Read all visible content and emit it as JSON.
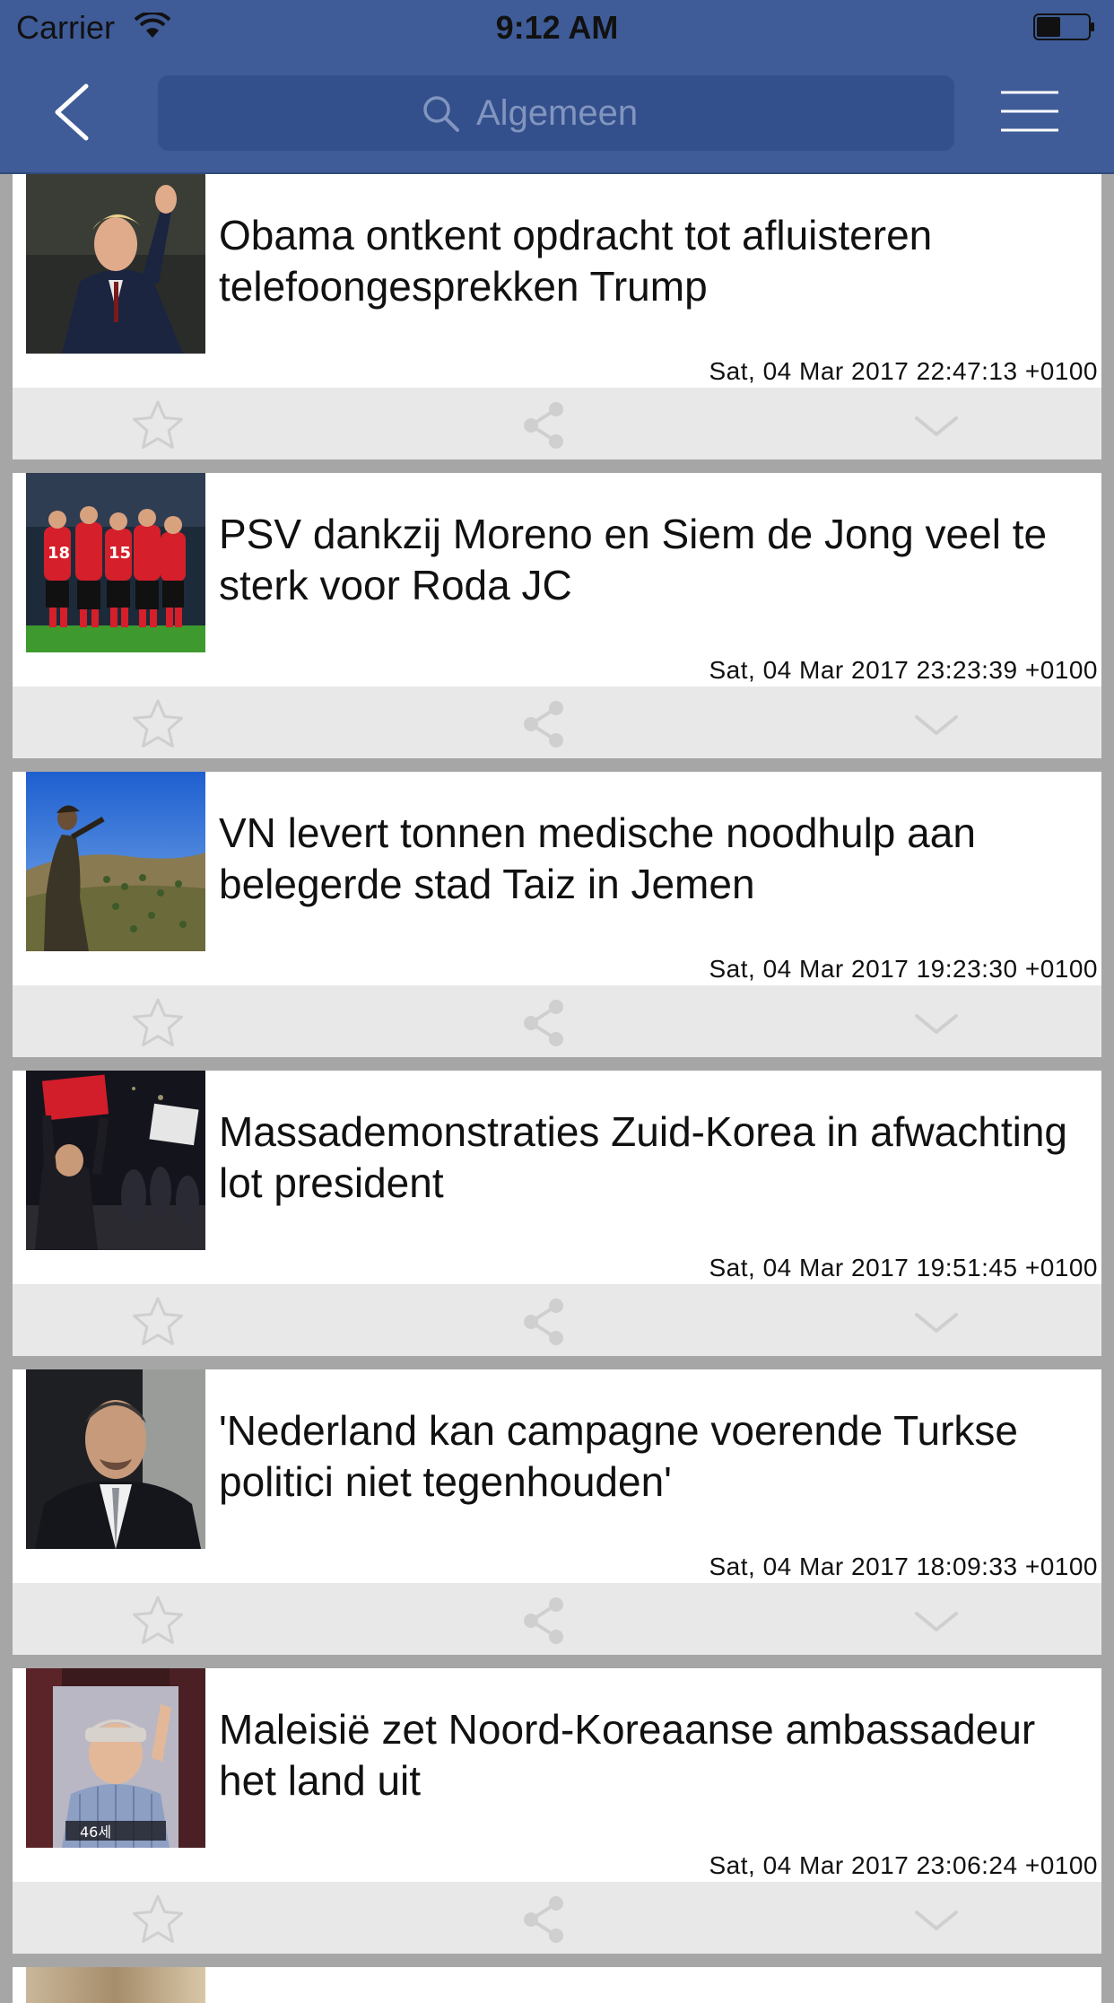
{
  "status_bar": {
    "carrier": "Carrier",
    "time": "9:12 AM"
  },
  "header": {
    "search": {
      "placeholder": "Algemeen"
    },
    "icons": {
      "back": "chevron-left-icon",
      "search": "search-icon",
      "menu": "hamburger-menu-icon"
    }
  },
  "colors": {
    "header_bg": "#3f5c98",
    "search_bg": "#34508c",
    "feed_bg": "#a6a6a6",
    "card_bg": "#ffffff",
    "action_bar_bg": "#e8e8e8",
    "action_icon": "#cfcfcf"
  },
  "articles": [
    {
      "title": "Obama ontkent opdracht tot afluisteren telefoongesprekken Trump",
      "date": "Sat, 04 Mar 2017 22:47:13 +0100"
    },
    {
      "title": "PSV dankzij Moreno en Siem de Jong veel te sterk voor Roda JC",
      "date": "Sat, 04 Mar 2017 23:23:39 +0100"
    },
    {
      "title": "VN levert tonnen medische noodhulp aan belegerde stad Taiz in Jemen",
      "date": "Sat, 04 Mar 2017 19:23:30 +0100"
    },
    {
      "title": "Massademonstraties Zuid-Korea in afwachting lot president",
      "date": "Sat, 04 Mar 2017 19:51:45 +0100"
    },
    {
      "title": "'Nederland kan campagne voerende Turkse politici niet tegenhouden'",
      "date": "Sat, 04 Mar 2017 18:09:33 +0100"
    },
    {
      "title": "Maleisië zet Noord-Koreaanse ambassadeur het land uit",
      "date": "Sat, 04 Mar 2017 23:06:24 +0100"
    }
  ],
  "card_actions": {
    "favorite_icon": "star-icon",
    "share_icon": "share-icon",
    "expand_icon": "chevron-down-icon"
  }
}
